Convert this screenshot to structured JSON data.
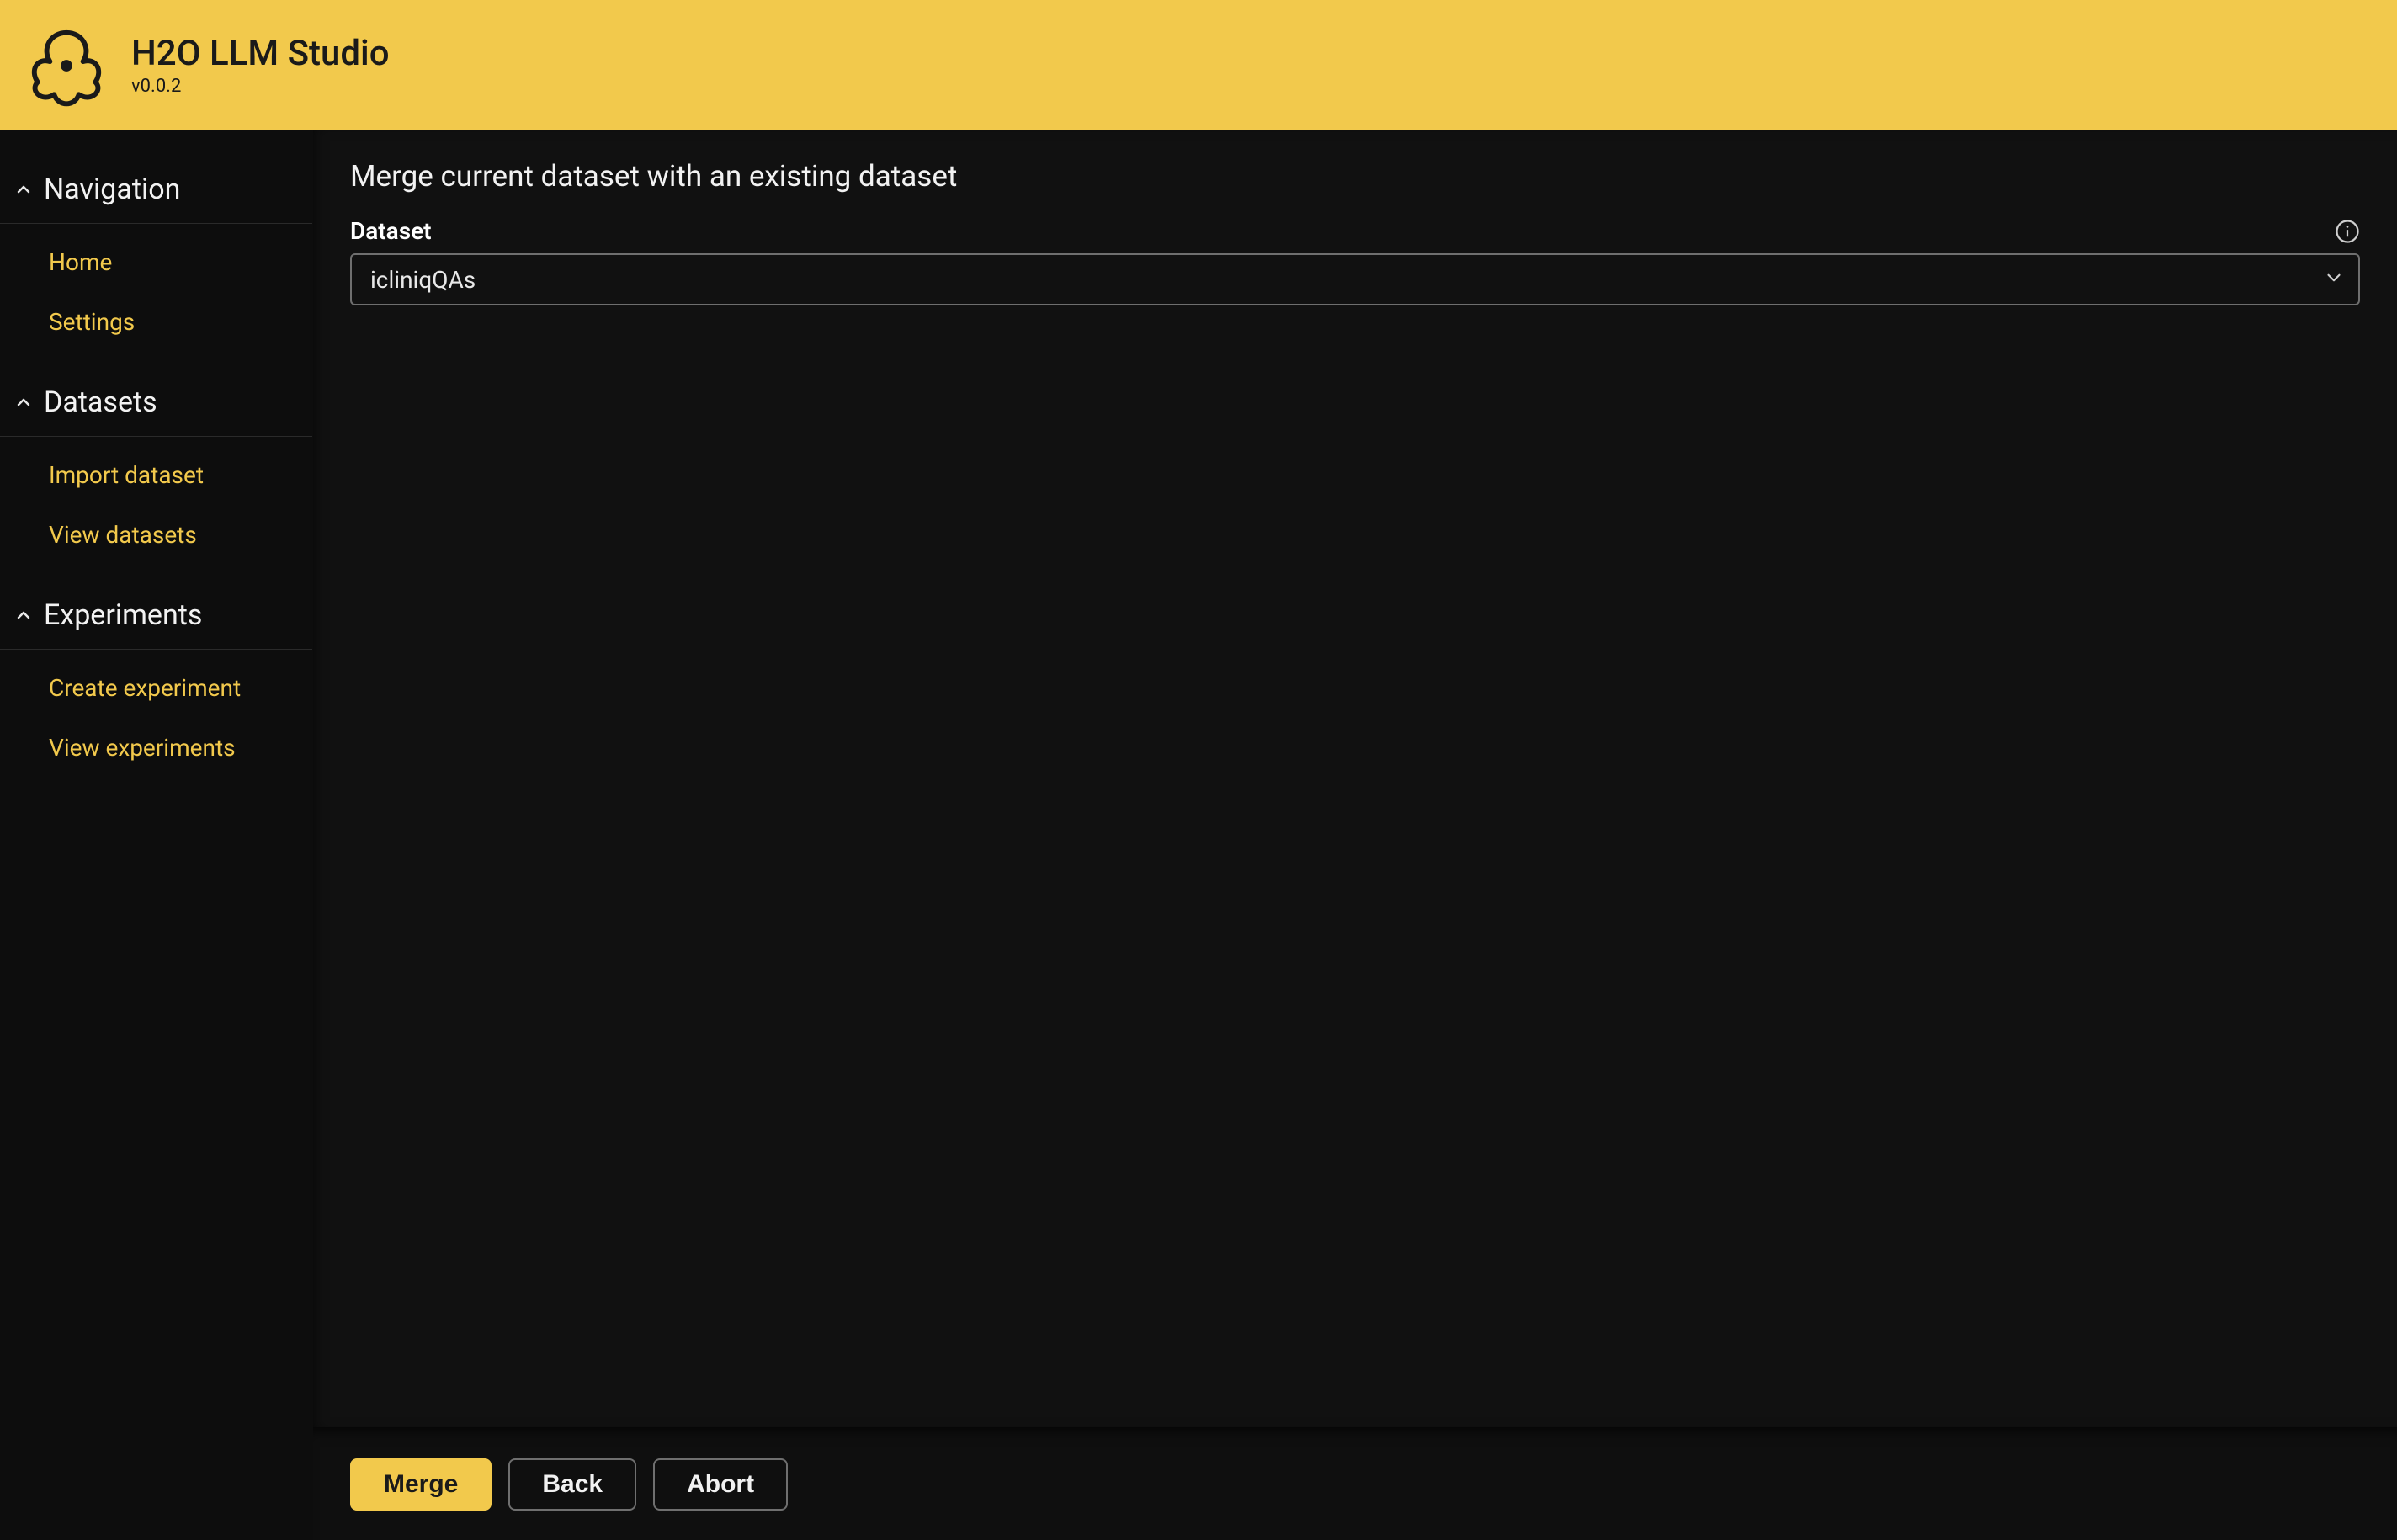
{
  "header": {
    "title": "H2O LLM Studio",
    "version": "v0.0.2"
  },
  "sidebar": {
    "groups": [
      {
        "title": "Navigation",
        "items": [
          {
            "label": "Home"
          },
          {
            "label": "Settings"
          }
        ]
      },
      {
        "title": "Datasets",
        "items": [
          {
            "label": "Import dataset"
          },
          {
            "label": "View datasets"
          }
        ]
      },
      {
        "title": "Experiments",
        "items": [
          {
            "label": "Create experiment"
          },
          {
            "label": "View experiments"
          }
        ]
      }
    ]
  },
  "main": {
    "title": "Merge current dataset with an existing dataset",
    "dataset_label": "Dataset",
    "dataset_selected": "icliniqQAs"
  },
  "footer": {
    "merge_label": "Merge",
    "back_label": "Back",
    "abort_label": "Abort"
  }
}
